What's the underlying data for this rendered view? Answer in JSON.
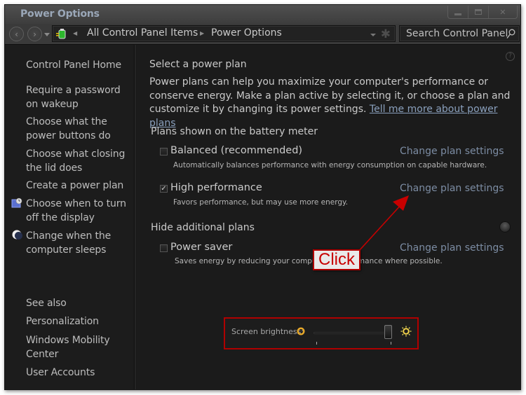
{
  "window": {
    "title": "Power Options",
    "controls": {
      "minimize": "minimize",
      "maximize": "maximize",
      "close": "close"
    }
  },
  "navbar": {
    "back_icon": "back-arrow-icon",
    "forward_icon": "forward-arrow-icon",
    "breadcrumb": [
      "All Control Panel Items",
      "Power Options"
    ],
    "search_placeholder": "Search Control Panel"
  },
  "sidebar": {
    "home": "Control Panel Home",
    "tasks": [
      {
        "label_lines": [
          "Require a password",
          "on wakeup"
        ],
        "icon": null
      },
      {
        "label_lines": [
          "Choose what the",
          "power buttons do"
        ],
        "icon": null
      },
      {
        "label_lines": [
          "Choose what closing",
          "the lid does"
        ],
        "icon": null
      },
      {
        "label_lines": [
          "Create a power plan"
        ],
        "icon": null
      },
      {
        "label_lines": [
          "Choose when to turn",
          "off the display"
        ],
        "icon": "display-timer-icon"
      },
      {
        "label_lines": [
          "Change when the",
          "computer sleeps"
        ],
        "icon": "moon-icon"
      }
    ],
    "see_also": {
      "heading": "See also",
      "links": [
        {
          "label_lines": [
            "Personalization"
          ]
        },
        {
          "label_lines": [
            "Windows Mobility",
            "Center"
          ]
        },
        {
          "label_lines": [
            "User Accounts"
          ]
        }
      ]
    }
  },
  "main": {
    "title": "Select a power plan",
    "description": "Power plans can help you maximize your computer's performance or conserve energy. Make a plan active by selecting it, or choose a plan and customize it by changing its power settings.",
    "learn_more_link": "Tell me more about power plans",
    "battery_meter_heading": "Plans shown on the battery meter",
    "plans": [
      {
        "name": "Balanced (recommended)",
        "description": "Automatically balances performance with energy consumption on capable hardware.",
        "selected": false,
        "link": "Change plan settings"
      },
      {
        "name": "High performance",
        "description": "Favors performance, but may use more energy.",
        "selected": true,
        "link": "Change plan settings"
      }
    ],
    "additional_heading": "Hide additional plans",
    "additional_plans": [
      {
        "name": "Power saver",
        "description": "Saves energy by reducing your computer's performance where possible.",
        "selected": false,
        "link": "Change plan settings"
      }
    ],
    "help_icon": "?"
  },
  "brightness": {
    "label": "Screen brightness:",
    "value_percent": 100
  },
  "annotation": {
    "label": "Click",
    "color": "#c80000"
  }
}
